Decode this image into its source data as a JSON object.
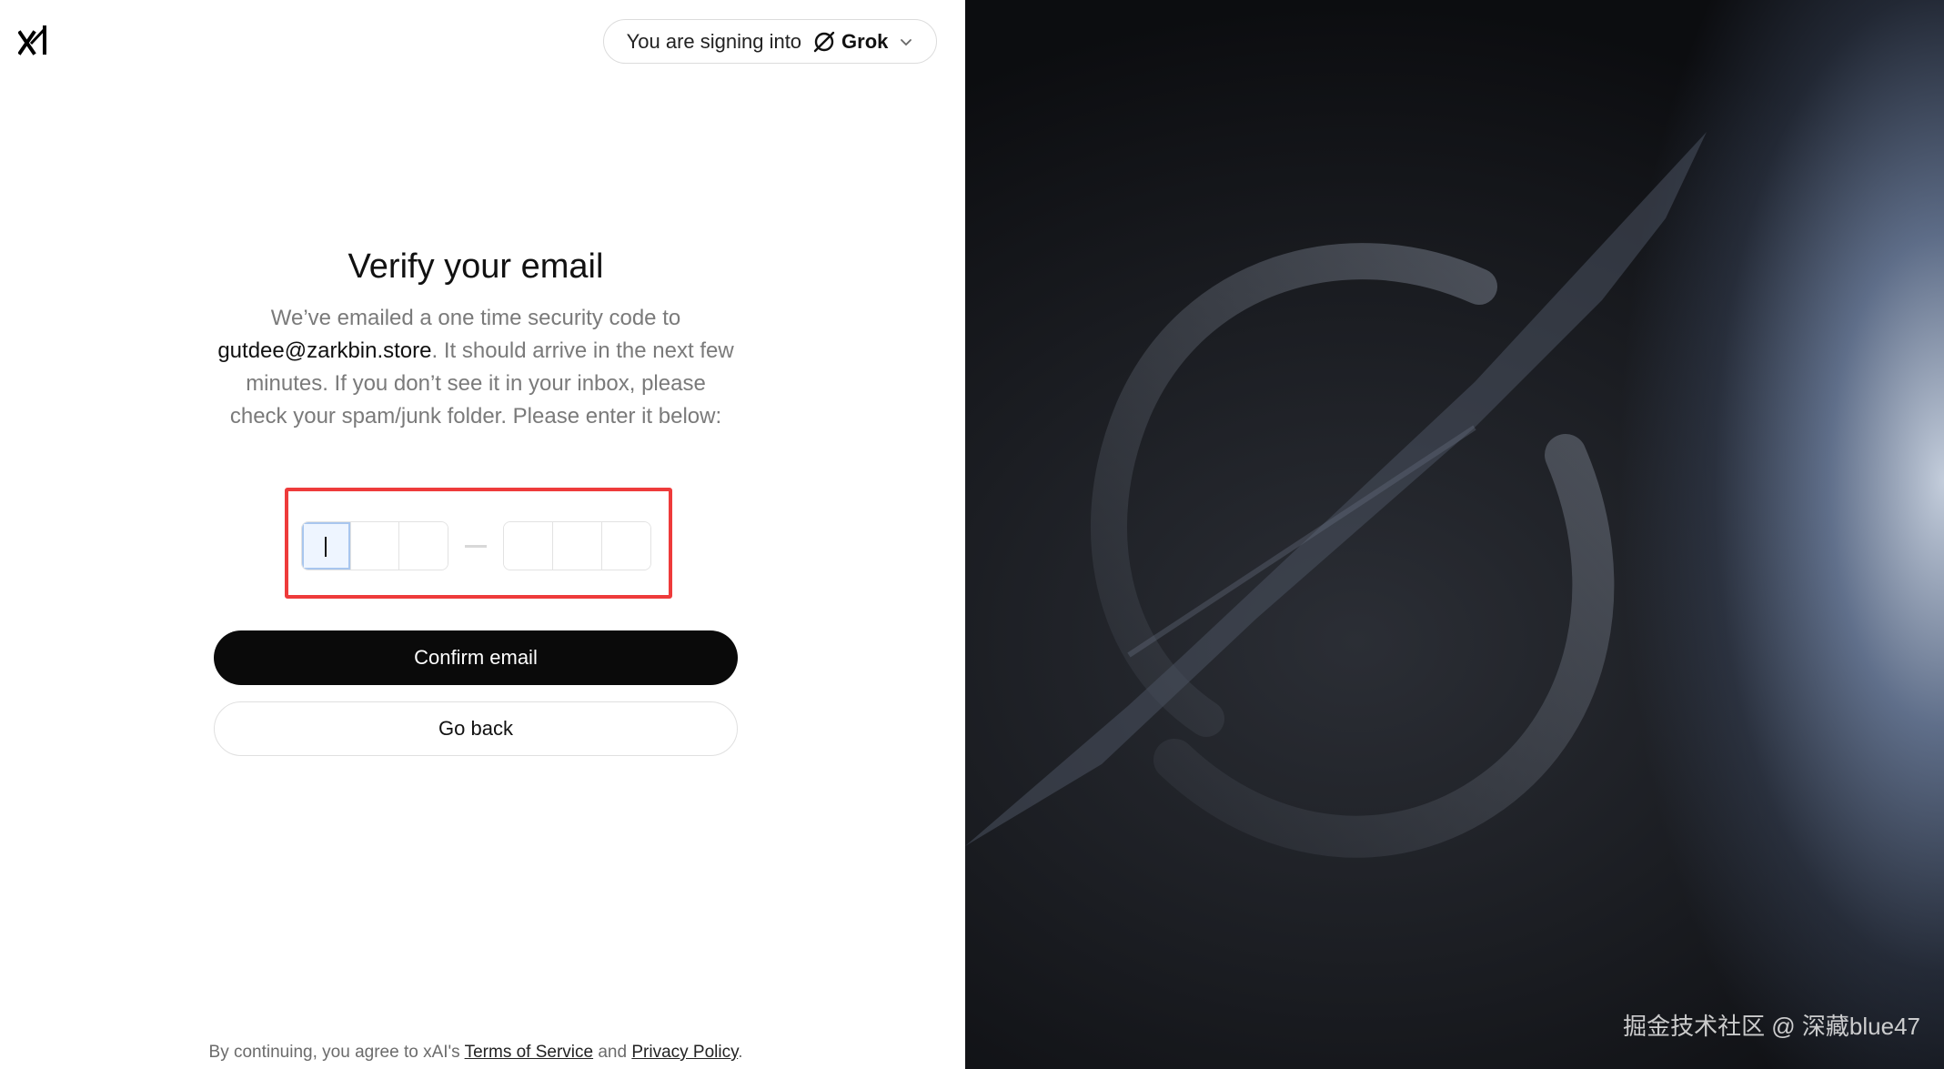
{
  "header": {
    "signing_prefix": "You are signing into",
    "product_name": "Grok"
  },
  "verify": {
    "title": "Verify your email",
    "desc_before": "We’ve emailed a one time security code to ",
    "email": "gutdee@zarkbin.store",
    "desc_after": ". It should arrive in the next few minutes. If you don’t see it in your inbox, please check your spam/junk folder. Please enter it below:"
  },
  "buttons": {
    "confirm": "Confirm email",
    "back": "Go back"
  },
  "footer": {
    "prefix": "By continuing, you agree to xAI's ",
    "terms": "Terms of Service",
    "and": " and ",
    "privacy": "Privacy Policy",
    "suffix": "."
  },
  "watermark": "掘金技术社区 @ 深藏blue47",
  "colors": {
    "primary_button": "#0a0a0a",
    "highlight_border": "#ee3b3b"
  }
}
